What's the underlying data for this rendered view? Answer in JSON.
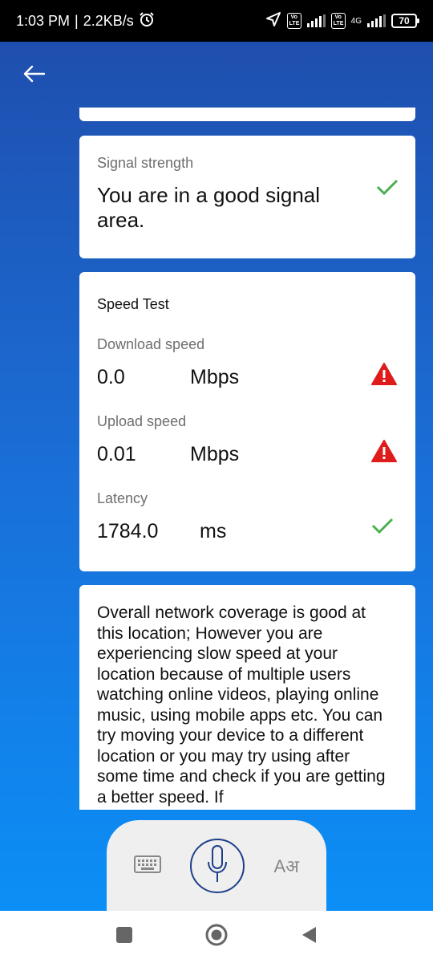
{
  "status_bar": {
    "time": "1:03 PM",
    "separator": "|",
    "speed": "2.2KB/s",
    "sim1_label": "Vo LTE",
    "sim2_label": "Vo LTE",
    "network_type": "4G",
    "battery_level": "70"
  },
  "signal_card": {
    "label": "Signal strength",
    "message": "You are in a good signal area.",
    "status_icon": "check-icon"
  },
  "speed_card": {
    "title": "Speed Test",
    "download": {
      "label": "Download speed",
      "value": "0.0",
      "unit": "Mbps",
      "status_icon": "warning-icon"
    },
    "upload": {
      "label": "Upload speed",
      "value": "0.01",
      "unit": "Mbps",
      "status_icon": "warning-icon"
    },
    "latency": {
      "label": "Latency",
      "value": "1784.0",
      "unit": "ms",
      "status_icon": "check-icon"
    }
  },
  "advice_card": {
    "text": "Overall network coverage is good at this location; However you are experiencing slow speed at your location because of multiple users watching online videos, playing online music, using mobile apps etc. You can try moving your device to a different location or you may try using after some time and check if you are getting a better speed. If"
  },
  "input_panel": {
    "language_glyph": "Aअ"
  },
  "colors": {
    "check": "#4caf50",
    "warning": "#e01b1b",
    "mic": "#1d3f8a"
  }
}
